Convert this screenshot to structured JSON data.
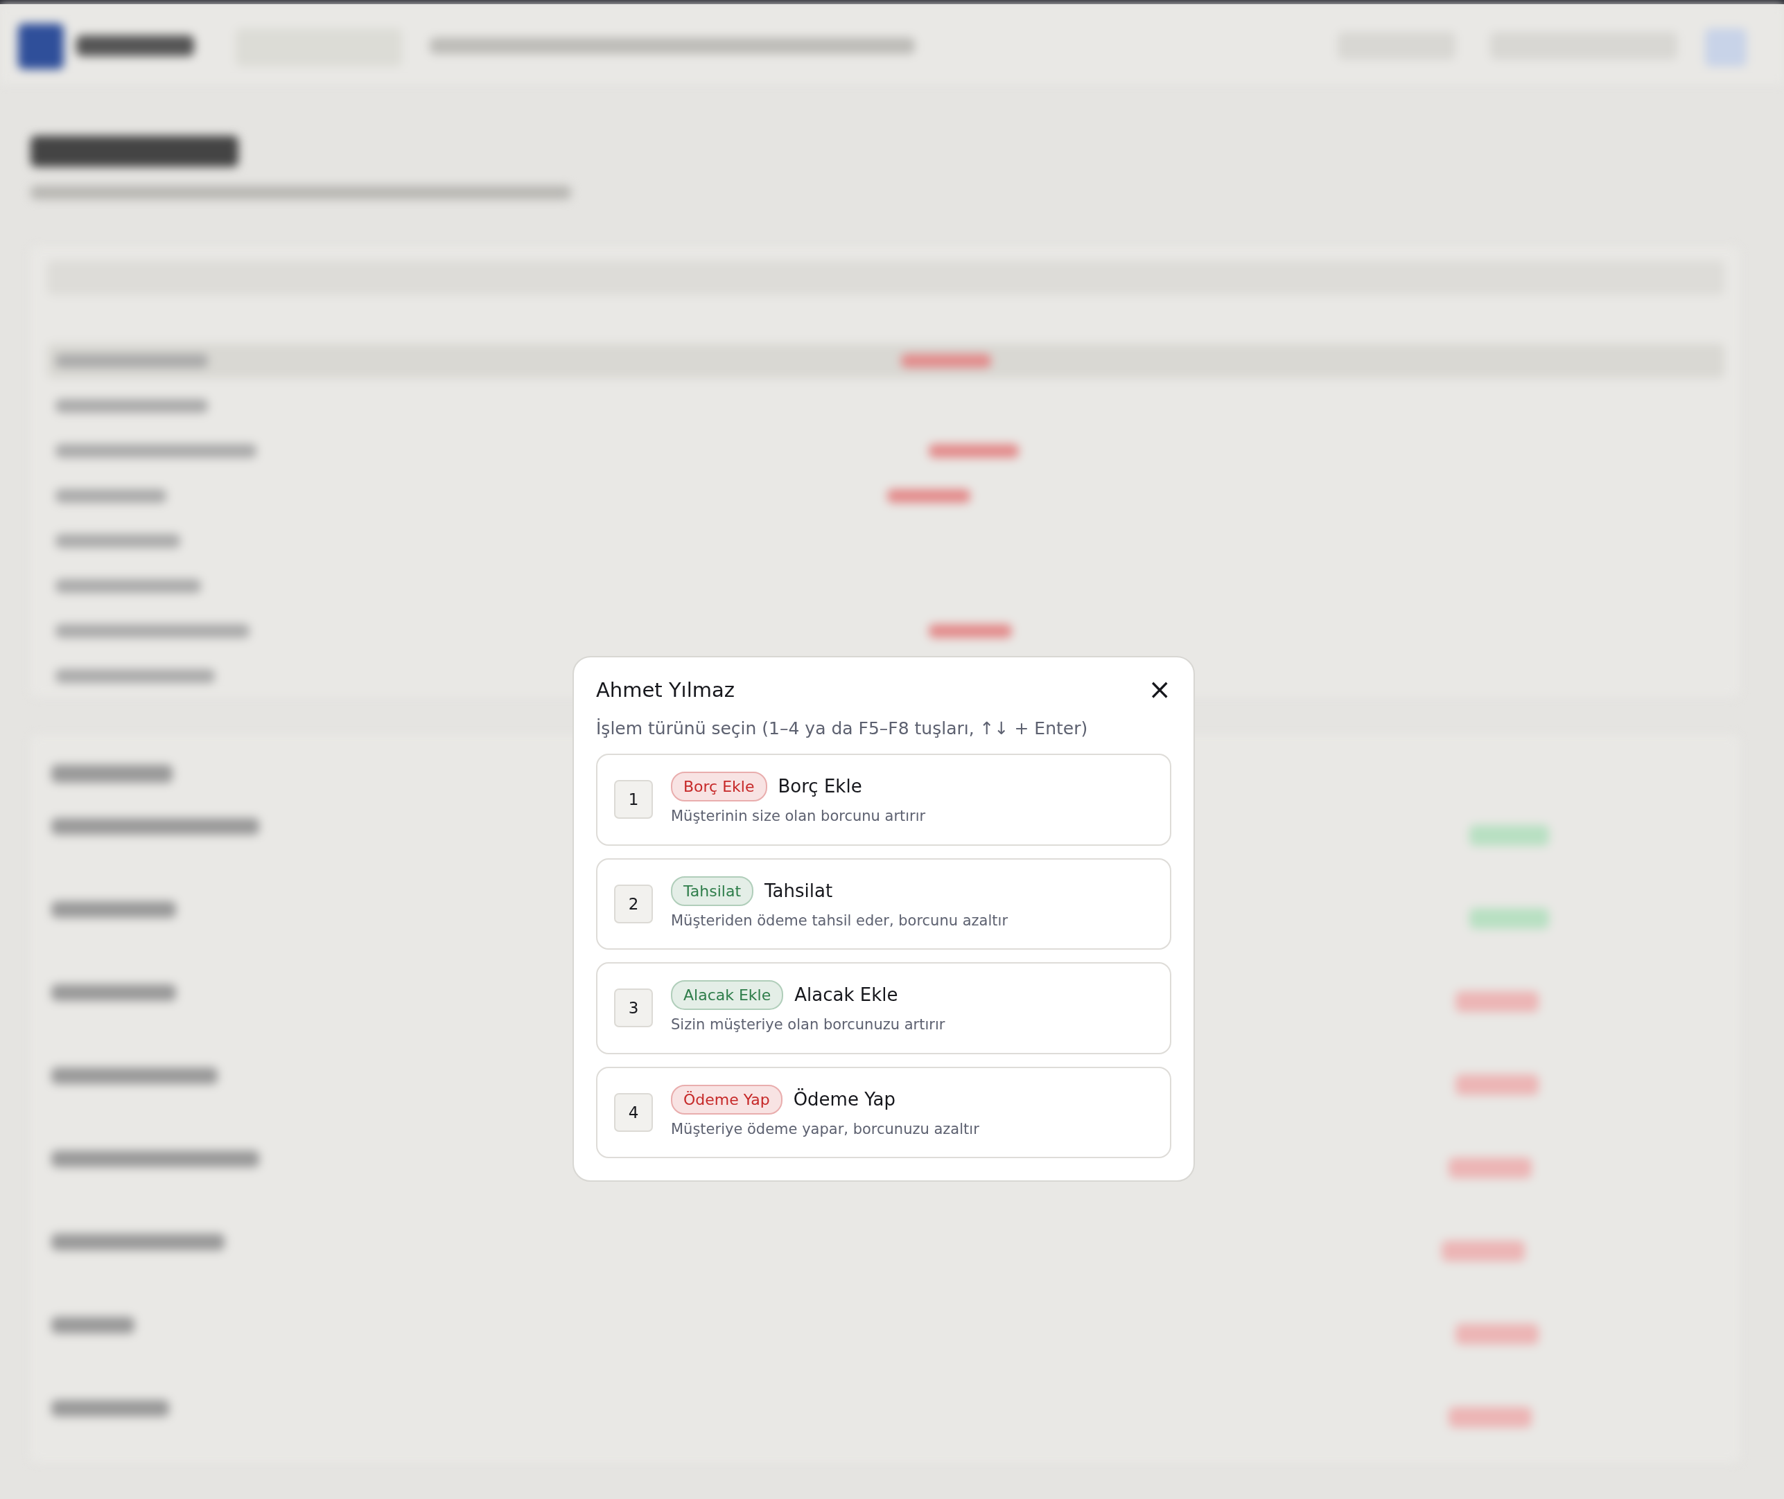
{
  "dialog": {
    "title": "Ahmet Yılmaz",
    "subtitle": "İşlem türünü seçin (1–4 ya da F5–F8 tuşları, ↑↓ + Enter)",
    "close": "×",
    "options": [
      {
        "key": "1",
        "badge": "Borç Ekle",
        "color": "#c62828",
        "title": "Borç Ekle",
        "description": "Müşterinin size olan borcunu artırır"
      },
      {
        "key": "2",
        "badge": "Tahsilat",
        "color": "#2e7d4a",
        "title": "Tahsilat",
        "description": "Müşteriden ödeme tahsil eder, borcunu azaltır"
      },
      {
        "key": "3",
        "badge": "Alacak Ekle",
        "color": "#2e7d4a",
        "title": "Alacak Ekle",
        "description": "Sizin müşteriye olan borcunuzu artırır"
      },
      {
        "key": "4",
        "badge": "Ödeme Yap",
        "color": "#c62828",
        "title": "Ödeme Yap",
        "description": "Müşteriye ödeme yapar, borcunuzu azaltır"
      }
    ]
  }
}
